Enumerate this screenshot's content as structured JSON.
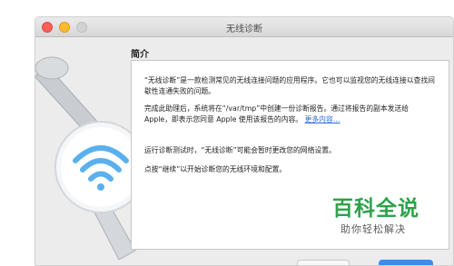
{
  "window": {
    "title": "无线诊断"
  },
  "content": {
    "section_title": "简介",
    "paragraph1": "“无线诊断”是一款检测常见的无线连接问题的应用程序。它也可以监视您的无线连接以查找间歇性连通失败的问题。",
    "paragraph2": "完成此助理后，系统将在“/var/tmp”中创建一份诊断报告。通过将报告的副本发送给 Apple，即表示您同意 Apple 使用该报告的内容。",
    "more_info_link": "更多内容…",
    "paragraph3": "运行诊断测试时，“无线诊断”可能会暂时更改您的网络设置。",
    "paragraph4": "点按“继续”以开始诊断您的无线环境和配置。"
  },
  "watermark": {
    "main": "百科全说",
    "sub": "助你轻松解决"
  },
  "colors": {
    "close": "#fc5f57",
    "minimize": "#fdbc2e",
    "link": "#2f6fd6",
    "primary_button": "#3b8df0",
    "watermark_green": "#2ea24a"
  },
  "icons": [
    "wifi-icon",
    "wrench-icon"
  ]
}
